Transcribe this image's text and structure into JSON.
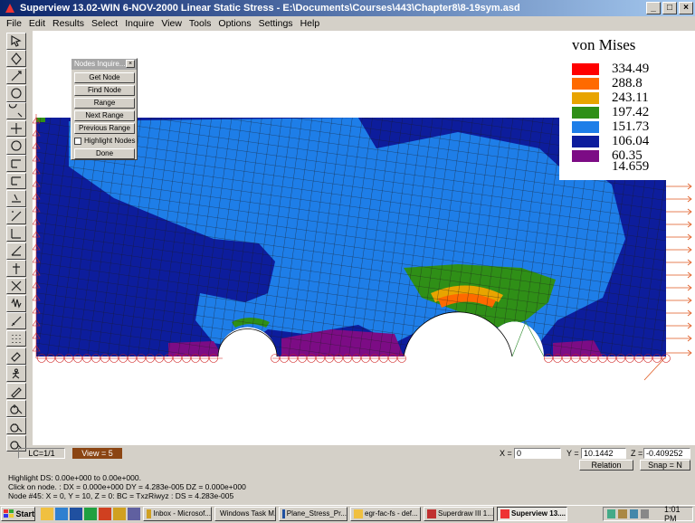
{
  "window": {
    "title": "Superview 13.02-WIN 6-NOV-2000 Linear Static Stress - E:\\Documents\\Courses\\443\\Chapter8\\8-19sym.asd"
  },
  "menu": [
    "File",
    "Edit",
    "Results",
    "Select",
    "Inquire",
    "View",
    "Tools",
    "Options",
    "Settings",
    "Help"
  ],
  "toolbar_icons": [
    "arrow-select-icon",
    "rotate-icon",
    "pointer-icon",
    "orbit-icon",
    "zoom-window-icon",
    "pan-icon",
    "shade-sphere-icon",
    "fx-load-icon",
    "fy-load-icon",
    "mz-icon",
    "constraint-x-icon",
    "constraint-y-icon",
    "constraint-xy-icon",
    "node-icon",
    "element-icon",
    "spring-icon",
    "measure-icon",
    "grid-points-icon",
    "eraser-icon",
    "person-run-icon",
    "pencil-icon",
    "zoom-in-icon",
    "zoom-out-icon",
    "zoom-fit-icon"
  ],
  "legend": {
    "title": "von Mises",
    "levels": [
      {
        "value": "334.49",
        "color": "#ff0000"
      },
      {
        "value": "288.8",
        "color": "#ff6a00"
      },
      {
        "value": "243.11",
        "color": "#e8a400"
      },
      {
        "value": "197.42",
        "color": "#2f8f17"
      },
      {
        "value": "151.73",
        "color": "#1e7ee8"
      },
      {
        "value": "106.04",
        "color": "#0d1d9c"
      },
      {
        "value": "60.35",
        "color": "#7c0c85"
      },
      {
        "value": "14.659",
        "color": ""
      }
    ]
  },
  "dialog": {
    "title": "Nodes Inquire...",
    "buttons": [
      "Get Node",
      "Find Node",
      "Range",
      "Next Range",
      "Previous Range"
    ],
    "checkbox_label": "Highlight Nodes",
    "done_label": "Done"
  },
  "status": {
    "lc": "LC=1/1",
    "view": "View = 5",
    "x_label": "X =",
    "x_value": "0",
    "y_label": "Y =",
    "y_value": "10.1442",
    "z_label": "Z =",
    "z_value": "-0.409252",
    "relation_label": "Relation",
    "snap_label": "Snap = N",
    "line1": "Highlight DS: 0.00e+000 to 0.00e+000.",
    "line2": "Click on node.      : DX = 0.000e+000 DY = 4.283e-005 DZ = 0.000e+000",
    "line3": "Node #45: X = 0, Y = 10, Z = 0: BC = TxzRiwyz  : DS = 4.283e-005"
  },
  "taskbar": {
    "start": "Start",
    "tasks": [
      {
        "label": "Inbox - Microsof...",
        "active": false
      },
      {
        "label": "Windows Task M...",
        "active": false
      },
      {
        "label": "Plane_Stress_Pr...",
        "active": false
      },
      {
        "label": "egr-fac-fs - def...",
        "active": false
      },
      {
        "label": "Superdraw III 1...",
        "active": false
      },
      {
        "label": "Superview 13....",
        "active": true
      }
    ],
    "clock": "1:01 PM"
  }
}
